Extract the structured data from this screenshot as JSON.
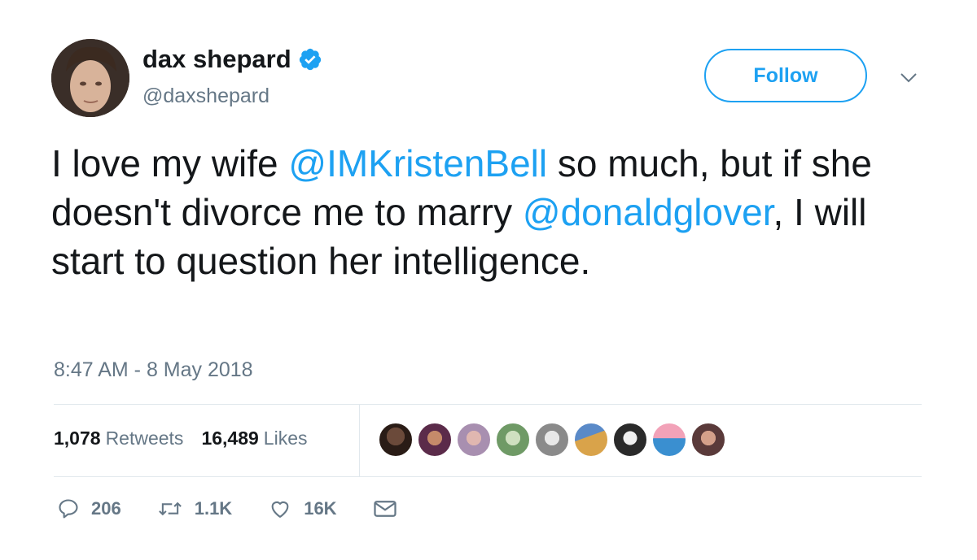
{
  "user": {
    "display_name": "dax shepard",
    "handle": "@daxshepard",
    "verified": true
  },
  "follow_label": "Follow",
  "tweet": {
    "parts": {
      "p1": "I love my wife ",
      "m1": "@IMKristenBell",
      "p2": " so much, but if she doesn't divorce me to marry ",
      "m2": "@donaldglover",
      "p3": ", I will start to question her intelligence."
    },
    "timestamp": "8:47 AM - 8 May 2018"
  },
  "stats": {
    "retweets_count": "1,078",
    "retweets_label": "Retweets",
    "likes_count": "16,489",
    "likes_label": "Likes"
  },
  "actions": {
    "reply_count": "206",
    "retweet_count": "1.1K",
    "like_count": "16K"
  },
  "icons": {
    "verified": "verified-badge-icon",
    "menu": "chevron-down-icon",
    "reply": "reply-icon",
    "retweet": "retweet-icon",
    "like": "heart-icon",
    "dm": "envelope-icon"
  },
  "colors": {
    "accent": "#1da1f2",
    "text": "#14171a",
    "muted": "#657786",
    "divider": "#e1e8ed"
  }
}
